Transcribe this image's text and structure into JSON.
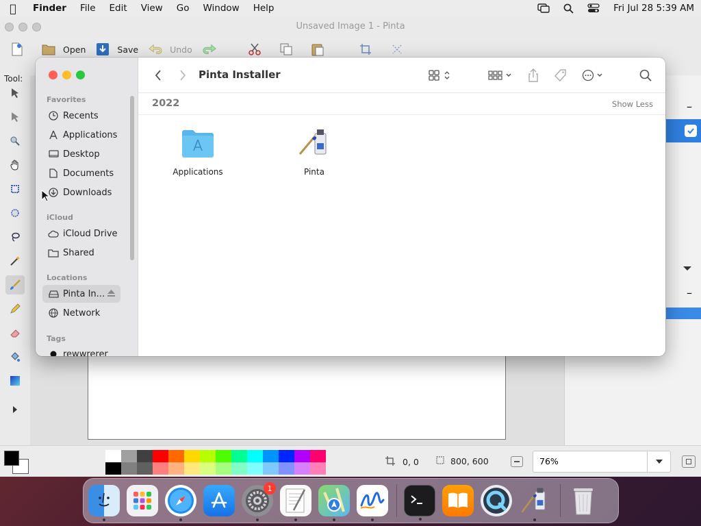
{
  "menubar": {
    "app": "Finder",
    "items": [
      "File",
      "Edit",
      "View",
      "Go",
      "Window",
      "Help"
    ],
    "clock": "Fri Jul 28  5:39 AM"
  },
  "pinta": {
    "title": "Unsaved Image 1 - Pinta",
    "toolbar": {
      "open": "Open",
      "save": "Save",
      "undo": "Undo"
    },
    "tool_label": "Tool:",
    "status": {
      "cursor_pos": "0, 0",
      "image_size": "800, 600",
      "zoom": "76%"
    },
    "palette": [
      "#ffffff",
      "#a0a0a0",
      "#404040",
      "#ff0000",
      "#ff6a00",
      "#ffd800",
      "#b6ff00",
      "#4cff00",
      "#00ff90",
      "#00ffff",
      "#0094ff",
      "#0026ff",
      "#b200ff",
      "#ff006e",
      "#000000",
      "#808080",
      "#606060",
      "#ff7f7f",
      "#ffb27f",
      "#ffe97f",
      "#daff7f",
      "#a5ff7f",
      "#7fffc5",
      "#7fffff",
      "#7fc9ff",
      "#7f92ff",
      "#d67fff",
      "#ff7fb6"
    ]
  },
  "finder": {
    "title": "Pinta Installer",
    "group": "2022",
    "show_less": "Show Less",
    "sidebar": {
      "favorites_head": "Favorites",
      "favorites": [
        {
          "label": "Recents",
          "icon": "clock-icon"
        },
        {
          "label": "Applications",
          "icon": "applications-icon"
        },
        {
          "label": "Desktop",
          "icon": "desktop-icon"
        },
        {
          "label": "Documents",
          "icon": "document-icon"
        },
        {
          "label": "Downloads",
          "icon": "download-icon"
        }
      ],
      "icloud_head": "iCloud",
      "icloud": [
        {
          "label": "iCloud Drive",
          "icon": "cloud-icon"
        },
        {
          "label": "Shared",
          "icon": "shared-folder-icon"
        }
      ],
      "locations_head": "Locations",
      "locations": [
        {
          "label": "Pinta In...",
          "icon": "disk-icon"
        },
        {
          "label": "Network",
          "icon": "globe-icon"
        }
      ],
      "tags_head": "Tags",
      "tags": [
        {
          "label": "rewwrerer",
          "color": "#111111"
        }
      ]
    },
    "files": [
      {
        "label": "Applications",
        "icon": "applications-folder-icon"
      },
      {
        "label": "Pinta",
        "icon": "pinta-app-icon"
      }
    ]
  },
  "dock": {
    "apps": [
      "Finder",
      "Launchpad",
      "Safari",
      "App Store",
      "System Settings",
      "TextEdit",
      "Maps",
      "Freeform",
      "Terminal",
      "Books",
      "QuickTime Player",
      "Pinta",
      "Trash"
    ],
    "settings_badge": "1"
  },
  "colors": {
    "accent": "#2f7fe0",
    "close": "#ff5f57",
    "minimize": "#febc2e",
    "zoom": "#28c840"
  }
}
